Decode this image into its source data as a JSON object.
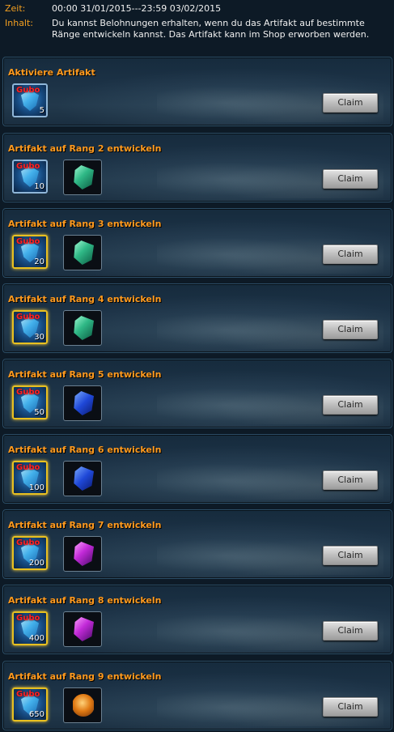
{
  "header": {
    "time_label": "Zeit:",
    "time_value": "00:00 31/01/2015---23:59 03/02/2015",
    "content_label": "Inhalt:",
    "content_value_line1": "Du kannst Belohnungen erhalten, wenn du das Artifakt auf bestimmte",
    "content_value_line2": "Ränge entwickeln kannst. Das Artifakt kann im Shop erworben werden."
  },
  "claim_label": "Claim",
  "rewards": [
    {
      "title": "Aktiviere Artifakt",
      "item1_label": "Gubo",
      "item1_qty": "5",
      "frame": "blue",
      "item2": null
    },
    {
      "title": "Artifakt auf Rang 2 entwickeln",
      "item1_label": "Gubo",
      "item1_qty": "10",
      "frame": "blue",
      "item2": "green"
    },
    {
      "title": "Artifakt auf Rang 3 entwickeln",
      "item1_label": "Gubo",
      "item1_qty": "20",
      "frame": "gold",
      "item2": "green"
    },
    {
      "title": "Artifakt auf Rang 4 entwickeln",
      "item1_label": "Gubo",
      "item1_qty": "30",
      "frame": "gold",
      "item2": "green"
    },
    {
      "title": "Artifakt auf Rang 5 entwickeln",
      "item1_label": "Gubo",
      "item1_qty": "50",
      "frame": "gold",
      "item2": "blue"
    },
    {
      "title": "Artifakt auf Rang 6 entwickeln",
      "item1_label": "Gubo",
      "item1_qty": "100",
      "frame": "gold",
      "item2": "blue"
    },
    {
      "title": "Artifakt auf Rang 7 entwickeln",
      "item1_label": "Gubo",
      "item1_qty": "200",
      "frame": "gold",
      "item2": "purple"
    },
    {
      "title": "Artifakt auf Rang 8 entwickeln",
      "item1_label": "Gubo",
      "item1_qty": "400",
      "frame": "gold",
      "item2": "purple"
    },
    {
      "title": "Artifakt auf Rang 9 entwickeln",
      "item1_label": "Gubo",
      "item1_qty": "650",
      "frame": "gold",
      "item2": "orange"
    }
  ]
}
